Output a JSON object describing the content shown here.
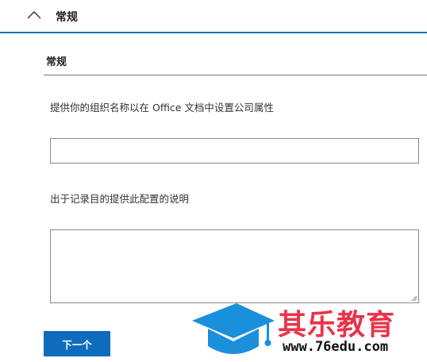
{
  "header": {
    "title": "常规",
    "chevron_icon": "chevron-up-icon",
    "accent_color": "#0a6fc2"
  },
  "section": {
    "title": "常规"
  },
  "fields": {
    "org_label": "提供你的组织名称以在 Office 文档中设置公司属性",
    "org_value": "",
    "desc_label": "出于记录目的提供此配置的说明",
    "desc_value": ""
  },
  "actions": {
    "next_label": "下一个",
    "next_color": "#0f6cbd"
  },
  "watermark": {
    "brand": "其乐教育",
    "url": "www.76edu.com",
    "logo_icon": "graduation-cap-icon",
    "brand_color": "#e8344a",
    "logo_color": "#1a8fdc"
  }
}
